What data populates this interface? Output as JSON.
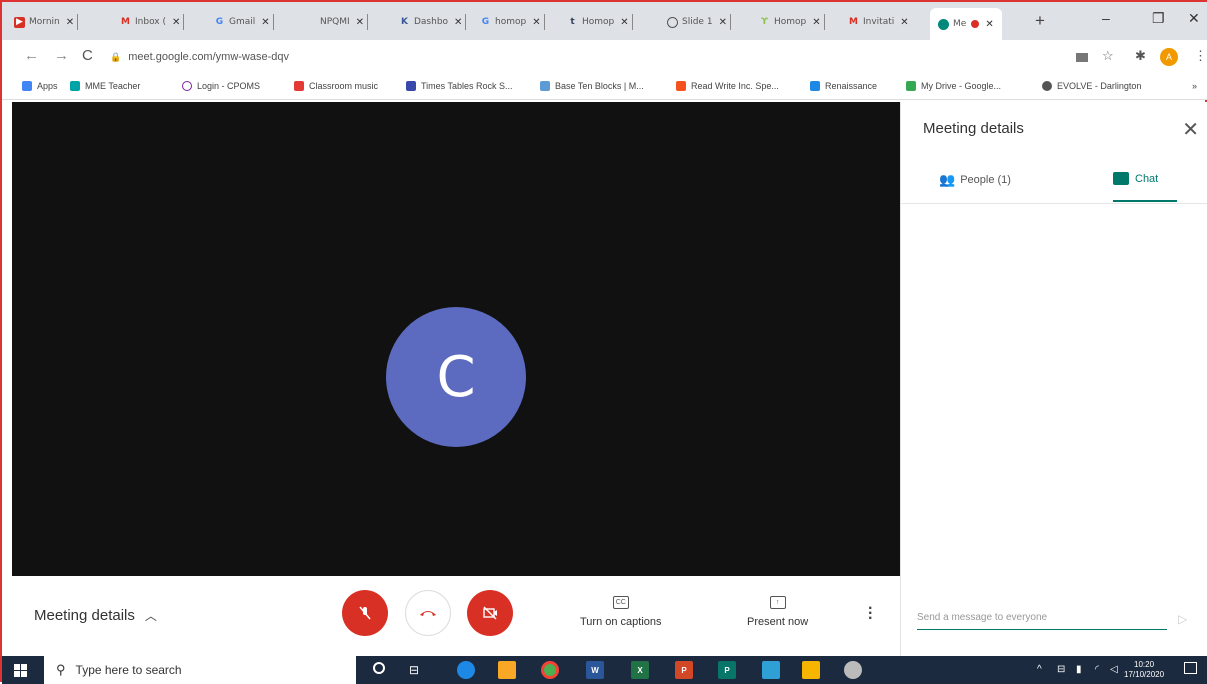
{
  "browser": {
    "tabs": [
      {
        "title": "Mornin",
        "fav_color": "#d93025",
        "fav_char": ""
      },
      {
        "title": "Inbox (",
        "fav_color": "#ffffff",
        "fav_char": "M"
      },
      {
        "title": "Gmail",
        "fav_color": "#ffffff",
        "fav_char": "G"
      },
      {
        "title": "NPQMI",
        "fav_color": "#ffffff",
        "fav_char": ""
      },
      {
        "title": "Dashbo",
        "fav_color": "#ffffff",
        "fav_char": "K"
      },
      {
        "title": "homop",
        "fav_color": "#ffffff",
        "fav_char": "G"
      },
      {
        "title": "Homop",
        "fav_color": "#ffffff",
        "fav_char": "t"
      },
      {
        "title": "Slide 1",
        "fav_color": "#ffffff",
        "fav_char": ""
      },
      {
        "title": "Homop",
        "fav_color": "#ffffff",
        "fav_char": ""
      },
      {
        "title": "Invitati",
        "fav_color": "#ffffff",
        "fav_char": "M"
      }
    ],
    "active_tab": {
      "title": "Me"
    },
    "url": "meet.google.com/ymw-wase-dqv",
    "bookmarks": [
      {
        "label": "Apps"
      },
      {
        "label": "MME Teacher"
      },
      {
        "label": "Login - CPOMS"
      },
      {
        "label": "Classroom music"
      },
      {
        "label": "Times Tables Rock S..."
      },
      {
        "label": "Base Ten Blocks | M..."
      },
      {
        "label": "Read Write Inc. Spe..."
      },
      {
        "label": "Renaissance"
      },
      {
        "label": "My Drive - Google..."
      },
      {
        "label": "EVOLVE - Darlington"
      }
    ],
    "bookmarks_more": "»",
    "profile_initial": "A"
  },
  "meet": {
    "participant_initial": "C",
    "meeting_details_label": "Meeting details",
    "captions_label": "Turn on captions",
    "present_label": "Present now",
    "side_panel": {
      "title": "Meeting details",
      "people_tab": "People (1)",
      "chat_tab": "Chat",
      "chat_placeholder": "Send a message to everyone"
    }
  },
  "taskbar": {
    "search_placeholder": "Type here to search",
    "time": "10:20",
    "date": "17/10/2020"
  },
  "colors": {
    "accent_teal": "#00796b",
    "red_button": "#d93025",
    "avatar": "#5c6bc0"
  }
}
